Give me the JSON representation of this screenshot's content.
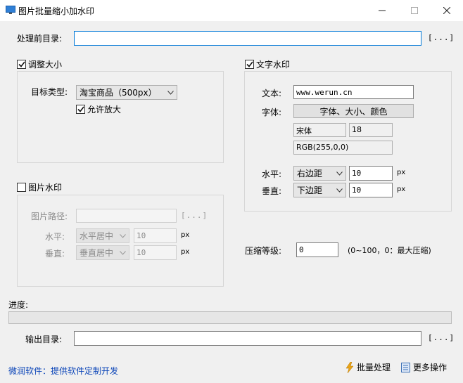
{
  "window": {
    "title": "图片批量缩小加水印"
  },
  "source_dir": {
    "label": "处理前目录:",
    "value": "",
    "browse": "[...]"
  },
  "resize": {
    "checkbox_label": "调整大小",
    "checked": true,
    "target_type_label": "目标类型:",
    "target_type_value": "淘宝商品（500px）",
    "allow_enlarge_label": "允许放大",
    "allow_enlarge_checked": true
  },
  "image_watermark": {
    "checkbox_label": "图片水印",
    "checked": false,
    "path_label": "图片路径:",
    "path_value": "",
    "browse": "[...]",
    "horizontal_label": "水平:",
    "horizontal_value": "水平居中",
    "horizontal_offset": "10",
    "vertical_label": "垂直:",
    "vertical_value": "垂直居中",
    "vertical_offset": "10",
    "unit": "px"
  },
  "text_watermark": {
    "checkbox_label": "文字水印",
    "checked": true,
    "text_label": "文本:",
    "text_value": "www.werun.cn",
    "font_label": "字体:",
    "font_button": "字体、大小、颜色",
    "font_name": "宋体",
    "font_size": "18",
    "color_value": "RGB(255,0,0)",
    "horizontal_label": "水平:",
    "horizontal_value": "右边距",
    "horizontal_offset": "10",
    "vertical_label": "垂直:",
    "vertical_value": "下边距",
    "vertical_offset": "10",
    "unit": "px"
  },
  "compression": {
    "label": "压缩等级:",
    "value": "0",
    "hint": "(0~100，0：最大压缩)"
  },
  "progress": {
    "label": "进度:",
    "value": 0
  },
  "output_dir": {
    "label": "输出目录:",
    "value": "",
    "browse": "[...]"
  },
  "footer": {
    "link": "微润软件：提供软件定制开发",
    "batch_button": "批量处理",
    "more_button": "更多操作"
  },
  "colors": {
    "accent": "#0078d7",
    "link": "#0b45b8",
    "lightning": "#e8a317"
  }
}
